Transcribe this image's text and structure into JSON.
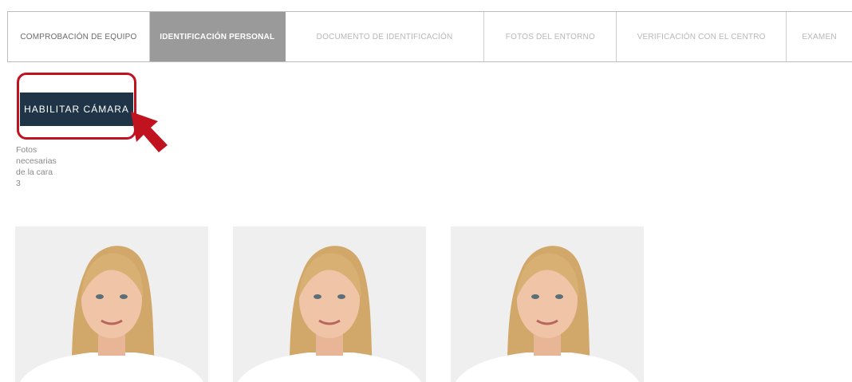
{
  "steps": [
    {
      "label": "COMPROBACIÓN DE EQUIPO",
      "state": "done"
    },
    {
      "label": "IDENTIFICACIÓN PERSONAL",
      "state": "active"
    },
    {
      "label": "DOCUMENTO DE IDENTIFICACIÓN",
      "state": "pending"
    },
    {
      "label": "FOTOS DEL ENTORNO",
      "state": "pending"
    },
    {
      "label": "VERIFICACIÓN CON EL CENTRO",
      "state": "pending"
    },
    {
      "label": "EXAMEN",
      "state": "pending"
    }
  ],
  "camera_button": {
    "label": "HABILITAR CÁMARA"
  },
  "info": {
    "lines": [
      "Fotos",
      "necesarias",
      "de la cara",
      "3"
    ]
  },
  "photos": [
    {
      "icon": "face-photo"
    },
    {
      "icon": "face-photo"
    },
    {
      "icon": "face-photo"
    }
  ],
  "colors": {
    "accent_highlight": "#c1121f",
    "button_bg": "#1f3446",
    "active_step_bg": "#9a9a9a"
  }
}
